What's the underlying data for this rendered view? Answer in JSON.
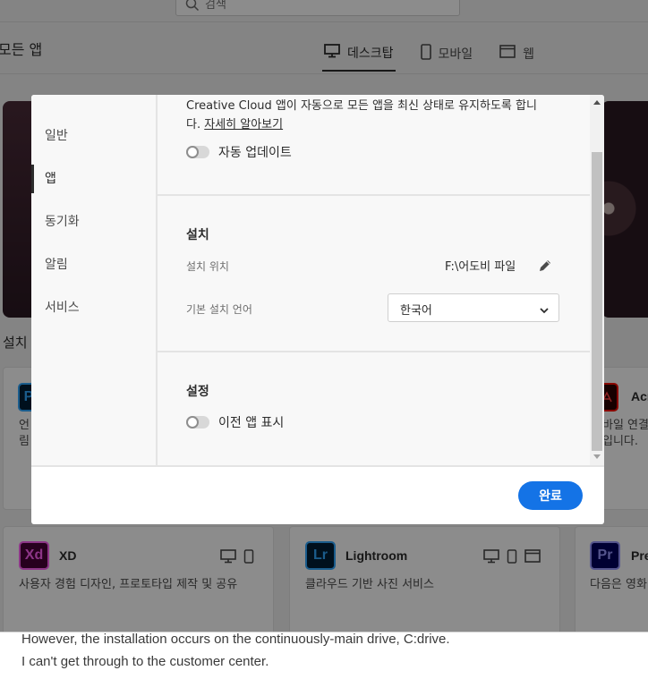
{
  "search": {
    "placeholder": "검색"
  },
  "header": {
    "title": "모든 앱"
  },
  "tabs": [
    {
      "label": "데스크탑",
      "icon": "desktop-icon"
    },
    {
      "label": "모바일",
      "icon": "mobile-icon"
    },
    {
      "label": "웹",
      "icon": "web-icon"
    }
  ],
  "installed_title": "설치",
  "cards": [
    {
      "abbr": "Xd",
      "name": "XD",
      "desc": "사용자 경험 디자인, 프로토타입 제작 및 공유",
      "logo_bg": "#470137",
      "logo_fg": "#ff61f6"
    },
    {
      "abbr": "Lr",
      "name": "Lightroom",
      "desc": "클라우드 기반 사진 서비스",
      "logo_bg": "#001e36",
      "logo_fg": "#31a8ff"
    },
    {
      "abbr": "Pr",
      "name": "Pre",
      "desc": "다음은 영화",
      "logo_bg": "#00005b",
      "logo_fg": "#9999ff"
    }
  ],
  "partial_cards": {
    "left_abbr": "P",
    "left_desc_1": "언",
    "left_desc_2": "림",
    "right_name": "Acr",
    "right_desc_1": "바일 연결",
    "right_desc_2": "입니다."
  },
  "modal": {
    "nav": [
      {
        "label": "일반"
      },
      {
        "label": "앱"
      },
      {
        "label": "동기화"
      },
      {
        "label": "알림"
      },
      {
        "label": "서비스"
      }
    ],
    "intro_line1": "Creative Cloud 앱이 자동으로 모든 앱을 최신 상태로 유지하도록 합니",
    "intro_line2_prefix": "다. ",
    "learn_more": "자세히 알아보기",
    "auto_update_label": "자동 업데이트",
    "install_heading": "설치",
    "install_location_label": "설치 위치",
    "install_location_value": "F:\\어도비 파일",
    "default_language_label": "기본 설치 언어",
    "default_language_value": "한국어",
    "settings_heading": "설정",
    "show_older_label": "이전 앱 표시",
    "done_button": "완료"
  },
  "post": {
    "line1": "However, the installation occurs on the continuously-main drive, C:drive.",
    "line2": "I can't get through to the customer center."
  },
  "colors": {
    "accent": "#1473e6",
    "overlay": "rgba(0,0,0,0.45)"
  }
}
